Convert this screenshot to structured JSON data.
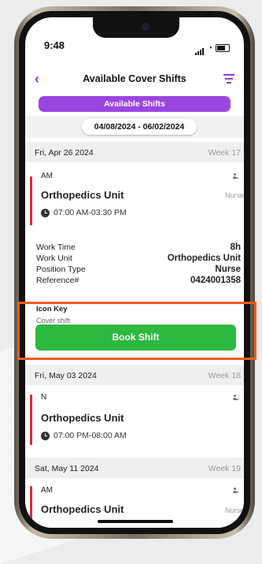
{
  "status": {
    "time": "9:48"
  },
  "header": {
    "title": "Available Cover Shifts"
  },
  "tab_pill": "Available Shifts",
  "date_range": "04/08/2024 - 06/02/2024",
  "days": [
    {
      "date": "Fri, Apr 26 2024",
      "week": "Week 17",
      "shift": "AM",
      "unit": "Orthopedics Unit",
      "time": "07:00 AM-03:30 PM",
      "role": "Nurse"
    },
    {
      "date": "Fri, May 03 2024",
      "week": "Week 18",
      "shift": "N",
      "unit": "Orthopedics Unit",
      "time": "07:00 PM-08:00 AM"
    },
    {
      "date": "Sat, May 11 2024",
      "week": "Week 19",
      "shift": "AM",
      "unit": "Orthopedics Unit",
      "role": "Nurse"
    }
  ],
  "details": {
    "work_time_label": "Work Time",
    "work_time": "8h",
    "work_unit_label": "Work Unit",
    "work_unit": "Orthopedics Unit",
    "position_label": "Position Type",
    "position": "Nurse",
    "reference_label": "Reference#",
    "reference": "0424001358"
  },
  "icon_key": {
    "title": "Icon Key",
    "cover": "Cover shift"
  },
  "book_button": "Book Shift",
  "colors": {
    "accent": "#9b45e0",
    "book": "#2db840",
    "bar": "#d92b3a",
    "highlight": "#f05a1e"
  }
}
